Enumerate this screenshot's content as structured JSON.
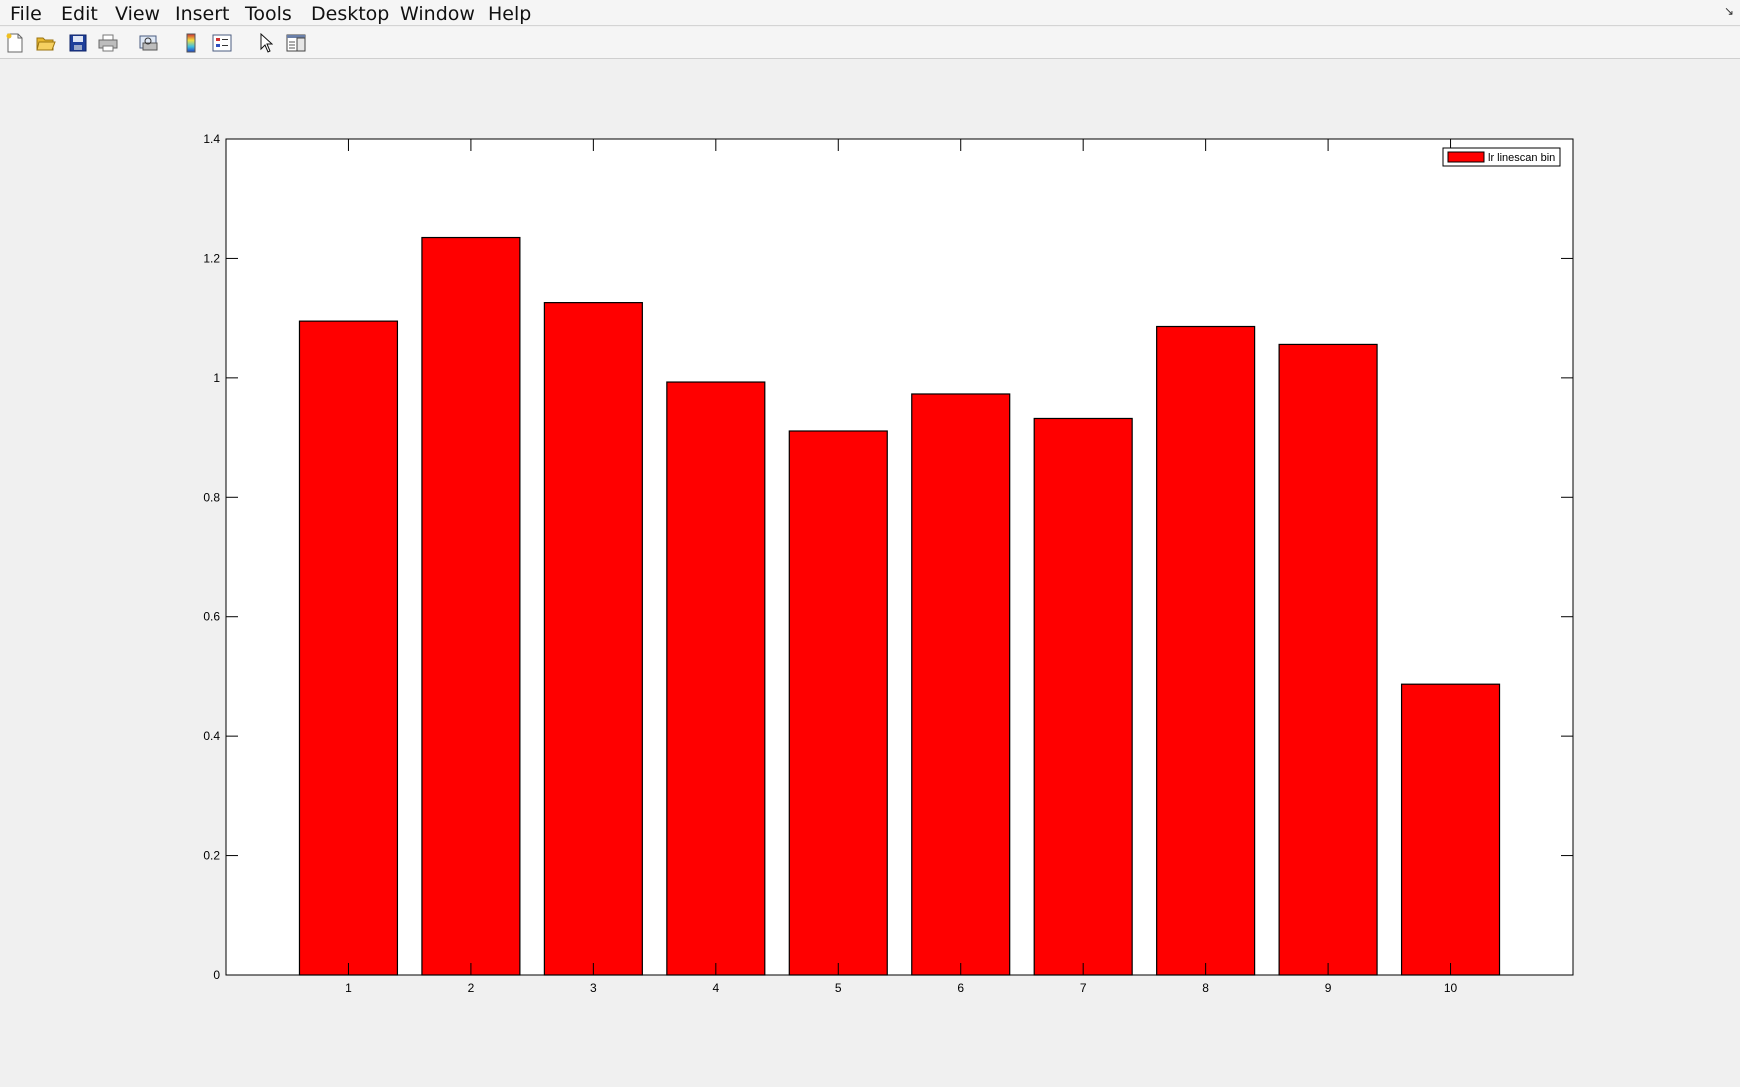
{
  "menu": {
    "items": [
      "File",
      "Edit",
      "View",
      "Insert",
      "Tools",
      "Desktop",
      "Window",
      "Help"
    ]
  },
  "toolbar": {
    "buttons": [
      "new-figure-icon",
      "open-file-icon",
      "save-icon",
      "print-icon",
      "print-preview-icon",
      "colorbar-icon",
      "legend-icon",
      "pointer-icon",
      "property-editor-icon"
    ]
  },
  "colors": {
    "bar_fill": "#ff0000",
    "bar_edge": "#000000",
    "axes_bg": "#ffffff",
    "figure_bg": "#f0f0f0"
  },
  "chart_data": {
    "type": "bar",
    "categories": [
      "1",
      "2",
      "3",
      "4",
      "5",
      "6",
      "7",
      "8",
      "9",
      "10"
    ],
    "series": [
      {
        "name": "lr linescan bin",
        "values": [
          1.095,
          1.235,
          1.126,
          0.993,
          0.911,
          0.973,
          0.932,
          1.086,
          1.056,
          0.487
        ]
      }
    ],
    "xlim": [
      0,
      11
    ],
    "ylim": [
      0,
      1.4
    ],
    "yticks": [
      0,
      0.2,
      0.4,
      0.6,
      0.8,
      1,
      1.2,
      1.4
    ],
    "ytick_labels": [
      "0",
      "0.2",
      "0.4",
      "0.6",
      "0.8",
      "1",
      "1.2",
      "1.4"
    ],
    "xlabel": "",
    "ylabel": "",
    "title": "",
    "grid": false,
    "legend_position": "top-right",
    "legend_label": "lr linescan bin"
  }
}
